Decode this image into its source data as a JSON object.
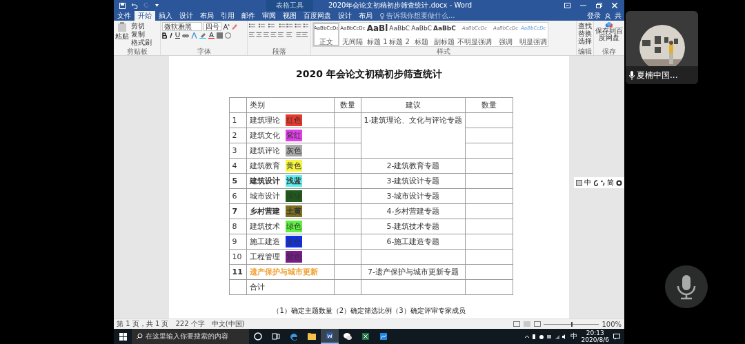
{
  "title_bar": {
    "title": "2020年会论文初稿初步筛查统计.docx - Word",
    "context_tab": "表格工具"
  },
  "tabs": [
    {
      "label": "文件",
      "selected": false
    },
    {
      "label": "开始",
      "selected": true
    },
    {
      "label": "插入",
      "selected": false
    },
    {
      "label": "设计",
      "selected": false
    },
    {
      "label": "布局",
      "selected": false
    },
    {
      "label": "引用",
      "selected": false
    },
    {
      "label": "邮件",
      "selected": false
    },
    {
      "label": "审阅",
      "selected": false
    },
    {
      "label": "视图",
      "selected": false
    },
    {
      "label": "百度网盘",
      "selected": false
    },
    {
      "label": "设计",
      "selected": false
    },
    {
      "label": "布局",
      "selected": false
    }
  ],
  "tell_me": {
    "placeholder": "告诉我你想要做什么..."
  },
  "account": {
    "sign_in": "登录",
    "share": "共"
  },
  "ribbon": {
    "clipboard": {
      "paste": "粘贴",
      "cut": "剪切",
      "copy": "复制",
      "format_painter": "格式刷",
      "label": "剪贴板"
    },
    "font": {
      "family": "微软雅黑",
      "size": "四号",
      "label": "字体"
    },
    "paragraph": {
      "label": "段落"
    },
    "styles": {
      "label": "样式",
      "items": [
        {
          "sample": "AaBbCcDc",
          "name": "正文",
          "kind": "normal",
          "selected": true
        },
        {
          "sample": "AaBbCcDc",
          "name": "无间隔",
          "kind": "normal",
          "selected": false
        },
        {
          "sample": "AaBl",
          "name": "标题 1",
          "kind": "heading1",
          "selected": false
        },
        {
          "sample": "AaBbC",
          "name": "标题 2",
          "kind": "heading2",
          "selected": false
        },
        {
          "sample": "AaBbC",
          "name": "标题",
          "kind": "heading2",
          "selected": false
        },
        {
          "sample": "AaBbC",
          "name": "副标题",
          "kind": "subtitle",
          "selected": false
        },
        {
          "sample": "AaBbCcDc",
          "name": "不明显强调",
          "kind": "subtle",
          "selected": false
        },
        {
          "sample": "AaBbCcDc",
          "name": "强调",
          "kind": "subtle",
          "selected": false
        },
        {
          "sample": "AaBbCcDc",
          "name": "明显强调",
          "kind": "intense",
          "selected": false
        }
      ]
    },
    "editing": {
      "find": "查找",
      "replace": "替换",
      "select": "选择",
      "label": "编辑"
    },
    "save": {
      "button": "保存到百度网盘",
      "label": "保存"
    }
  },
  "document": {
    "title": "2020 年会论文初稿初步筛查统计",
    "table": {
      "columns": [
        "类别",
        "数量",
        "建议",
        "数量"
      ],
      "rows": [
        {
          "number": "1",
          "category": "建筑理论",
          "kind": "swatch",
          "tag": "红色",
          "color": "#e8392c",
          "bold": false,
          "suggestion": "1-建筑理论、文化与评论专题",
          "merged_with_above": false
        },
        {
          "number": "2",
          "category": "建筑文化",
          "kind": "swatch",
          "tag": "紫红",
          "color": "#e040e8",
          "bold": false,
          "merged_with_above": true
        },
        {
          "number": "3",
          "category": "建筑评论",
          "kind": "swatch",
          "tag": "灰色",
          "color": "#a8a8a8",
          "bold": false,
          "merged_with_above": true
        },
        {
          "number": "4",
          "category": "建筑教育",
          "kind": "swatch",
          "tag": "黄色",
          "color": "#f5f542",
          "bold": false,
          "suggestion": "2-建筑教育专题",
          "merged_with_above": false
        },
        {
          "number": "5",
          "category": "建筑设计",
          "kind": "swatch",
          "tag": "浅蓝",
          "color": "#5ef0f0",
          "bold": true,
          "suggestion": "3-建筑设计专题",
          "merged_with_above": false
        },
        {
          "number": "6",
          "category": "城市设计",
          "kind": "swatch",
          "tag": "深绿",
          "color": "#1f5c1a",
          "bold": false,
          "suggestion": "3-城市设计专题",
          "merged_with_above": false
        },
        {
          "number": "7",
          "category": "乡村营建",
          "kind": "swatch",
          "tag": "土黄",
          "color": "#7d7020",
          "bold": true,
          "suggestion": "4-乡村营建专题",
          "merged_with_above": false
        },
        {
          "number": "8",
          "category": "建筑技术",
          "kind": "swatch",
          "tag": "绿色",
          "color": "#5ef040",
          "bold": false,
          "suggestion": "5-建筑技术专题",
          "merged_with_above": false
        },
        {
          "number": "9",
          "category": "施工建造",
          "kind": "swatch",
          "tag": "蓝色",
          "color": "#1030e8",
          "bold": false,
          "suggestion": "6-施工建造专题",
          "merged_with_above": false
        },
        {
          "number": "10",
          "category": "工程管理",
          "kind": "swatch",
          "tag": "紫色",
          "color": "#7a1a8c",
          "bold": false,
          "merged_with_above": false
        },
        {
          "number": "11",
          "category": "遗产保护与城市更新",
          "kind": "accent",
          "color": "#f0a030",
          "bold": true,
          "suggestion": "7-遗产保护与城市更新专题",
          "merged_with_above": false
        },
        {
          "category": "合计",
          "kind": "plain",
          "bold": false
        }
      ]
    },
    "note": "（1）确定主题数量（2）确定筛选比例（3）确定评审专家成员"
  },
  "ime_bar": {
    "mode": "中",
    "charset": "简"
  },
  "status_bar": {
    "page": "第 1 页，共 1 页",
    "words": "222 个字",
    "language": "中文(中国)",
    "zoom": "100%",
    "zoom_level": {
      "level": 0.5
    }
  },
  "taskbar": {
    "search": {
      "placeholder": "在这里输入你要搜索的内容"
    },
    "apps": [
      {
        "kind": "cortana",
        "selected": false
      },
      {
        "kind": "taskview",
        "selected": false
      },
      {
        "kind": "edge",
        "selected": false
      },
      {
        "kind": "explorer",
        "selected": false
      },
      {
        "kind": "word",
        "selected": true
      },
      {
        "kind": "wechat",
        "selected": false
      },
      {
        "kind": "excel",
        "selected": false
      },
      {
        "kind": "cloud",
        "selected": false
      }
    ],
    "ime": "中",
    "time": "20:13",
    "date": "2020/8/6"
  },
  "video_tile": {
    "name": "夏楠中国..."
  }
}
